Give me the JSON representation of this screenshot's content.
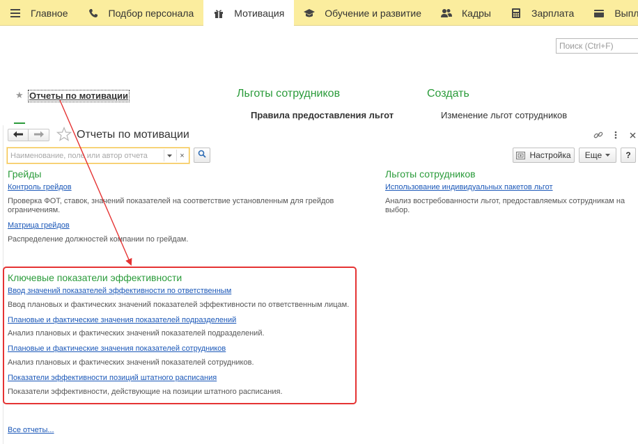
{
  "topnav": {
    "items": [
      {
        "label": "Главное",
        "icon": "hamburger-icon"
      },
      {
        "label": "Подбор персонала",
        "icon": "phone-icon"
      },
      {
        "label": "Мотивация",
        "icon": "gift-icon",
        "active": true
      },
      {
        "label": "Обучение и развитие",
        "icon": "graduation-cap-icon"
      },
      {
        "label": "Кадры",
        "icon": "people-icon"
      },
      {
        "label": "Зарплата",
        "icon": "calculator-icon"
      },
      {
        "label": "Выплаты",
        "icon": "wallet-icon"
      }
    ]
  },
  "global_search": {
    "placeholder": "Поиск (Ctrl+F)"
  },
  "background_panel": {
    "reports_link": "Отчеты по мотивации",
    "benefits_title": "Льготы сотрудников",
    "create_title": "Создать",
    "rules_link": "Правила предоставления льгот",
    "change_link": "Изменение льгот сотрудников"
  },
  "form": {
    "title": "Отчеты по мотивации",
    "filter_placeholder": "Наименование, поле или автор отчета",
    "settings_label": "Настройка",
    "more_label": "Еще",
    "help_label": "?",
    "sections": {
      "grades": {
        "title": "Грейды",
        "reports": [
          {
            "link": "Контроль грейдов",
            "desc": "Проверка ФОТ, ставок, значений показателей на соответствие установленным для грейдов ограничениям."
          },
          {
            "link": "Матрица грейдов",
            "desc": "Распределение должностей компании по грейдам."
          }
        ]
      },
      "benefits": {
        "title": "Льготы сотрудников",
        "reports": [
          {
            "link": "Использование индивидуальных пакетов льгот",
            "desc": "Анализ востребованности льгот, предоставляемых сотрудникам на выбор."
          }
        ]
      },
      "kpi": {
        "title": "Ключевые показатели эффективности",
        "reports": [
          {
            "link": "Ввод значений показателей эффективности по ответственным",
            "desc": "Ввод плановых и фактических значений показателей эффективности по ответственным лицам."
          },
          {
            "link": "Плановые и фактические значения показателей подразделений",
            "desc": "Анализ плановых и фактических значений показателей подразделений."
          },
          {
            "link": "Плановые и фактические значения показателей сотрудников",
            "desc": "Анализ плановых и фактических значений показателей сотрудников."
          },
          {
            "link": "Показатели эффективности позиций штатного расписания",
            "desc": "Показатели эффективности, действующие на позиции штатного расписания."
          }
        ]
      }
    },
    "all_reports": "Все отчеты..."
  },
  "colors": {
    "menu_bg": "#fbed9e",
    "section_green": "#2a9b3a",
    "link_blue": "#1a57b8",
    "annotation_red": "#e53333"
  }
}
